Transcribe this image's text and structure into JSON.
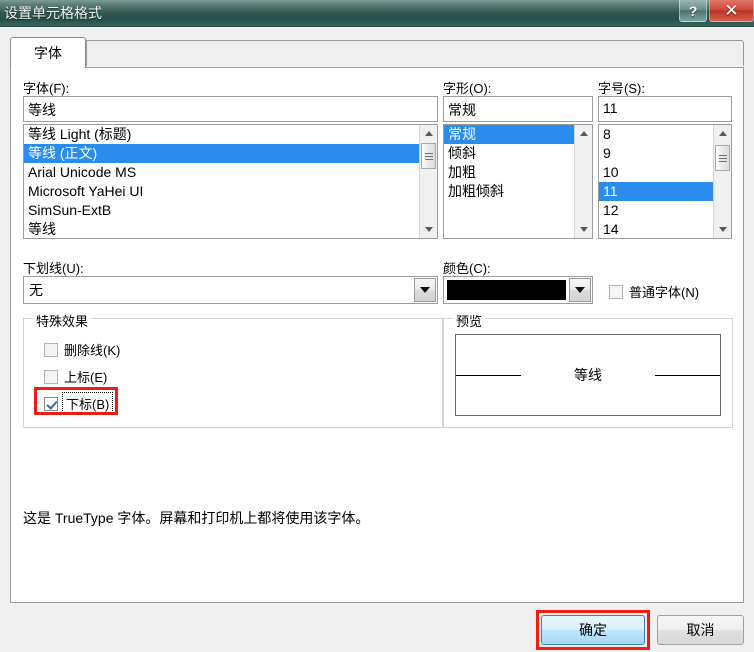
{
  "window": {
    "title": "设置单元格格式",
    "help_button": "?",
    "close_button": "✕"
  },
  "tabs": [
    {
      "label": "字体",
      "active": true
    }
  ],
  "font_section": {
    "label": "字体(F):",
    "value": "等线",
    "items": [
      {
        "label": "等线 Light (标题)",
        "selected": false
      },
      {
        "label": "等线 (正文)",
        "selected": true
      },
      {
        "label": "Arial Unicode MS",
        "selected": false
      },
      {
        "label": "Microsoft YaHei UI",
        "selected": false
      },
      {
        "label": "SimSun-ExtB",
        "selected": false
      },
      {
        "label": "等线",
        "selected": false
      }
    ]
  },
  "style_section": {
    "label": "字形(O):",
    "value": "常规",
    "items": [
      {
        "label": "常规",
        "selected": true
      },
      {
        "label": "倾斜",
        "selected": false
      },
      {
        "label": "加粗",
        "selected": false
      },
      {
        "label": "加粗倾斜",
        "selected": false
      }
    ]
  },
  "size_section": {
    "label": "字号(S):",
    "value": "11",
    "items": [
      {
        "label": "8",
        "selected": false
      },
      {
        "label": "9",
        "selected": false
      },
      {
        "label": "10",
        "selected": false
      },
      {
        "label": "11",
        "selected": true
      },
      {
        "label": "12",
        "selected": false
      },
      {
        "label": "14",
        "selected": false
      }
    ]
  },
  "underline_section": {
    "label": "下划线(U):",
    "value": "无"
  },
  "color_section": {
    "label": "颜色(C):",
    "value_color": "#000000"
  },
  "normal_font_checkbox": {
    "label": "普通字体(N)",
    "checked": false
  },
  "effects_group": {
    "title": "特殊效果",
    "items": [
      {
        "label": "删除线(K)",
        "checked": false,
        "focused": false,
        "annotated": false
      },
      {
        "label": "上标(E)",
        "checked": false,
        "focused": false,
        "annotated": false
      },
      {
        "label": "下标(B)",
        "checked": true,
        "focused": true,
        "annotated": true
      }
    ]
  },
  "preview_group": {
    "title": "预览",
    "sample_text": "等线"
  },
  "description": "这是 TrueType 字体。屏幕和打印机上都将使用该字体。",
  "buttons": {
    "ok": "确定",
    "cancel": "取消"
  },
  "annotation_color": "#ee1c11"
}
